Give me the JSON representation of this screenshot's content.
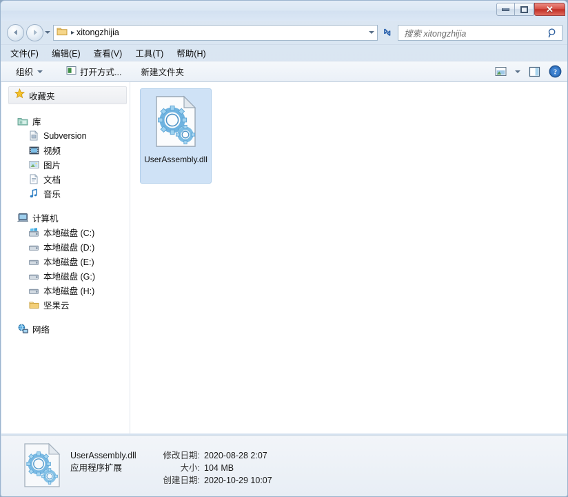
{
  "window": {
    "controls": {
      "minimize": "minimize-button",
      "maximize": "maximize-button",
      "close_label": "✕"
    }
  },
  "address_bar": {
    "folder_icon": "folder-icon",
    "separator": "▸",
    "path": "xitongzhijia",
    "dropdown_icon": "chevron-down-icon",
    "refresh_icon": "refresh-icon"
  },
  "search": {
    "placeholder": "搜索 xitongzhijia",
    "icon": "search-icon"
  },
  "menu": {
    "items": [
      {
        "label": "文件(F)"
      },
      {
        "label": "编辑(E)"
      },
      {
        "label": "查看(V)"
      },
      {
        "label": "工具(T)"
      },
      {
        "label": "帮助(H)"
      }
    ]
  },
  "toolbar": {
    "organize_label": "组织",
    "open_with_label": "打开方式...",
    "new_folder_label": "新建文件夹",
    "view_icon": "view-options-icon",
    "view_caret": "chevron-down-icon",
    "preview_pane_icon": "preview-pane-icon",
    "help_icon": "help-icon"
  },
  "sidebar": {
    "favorites": {
      "label": "收藏夹",
      "icon": "star-icon"
    },
    "groups": [
      {
        "header": {
          "label": "库",
          "icon": "library-folder-icon"
        },
        "items": [
          {
            "label": "Subversion",
            "icon": "subversion-icon"
          },
          {
            "label": "视频",
            "icon": "video-icon"
          },
          {
            "label": "图片",
            "icon": "picture-icon"
          },
          {
            "label": "文档",
            "icon": "document-icon"
          },
          {
            "label": "音乐",
            "icon": "music-icon"
          }
        ]
      },
      {
        "header": {
          "label": "计算机",
          "icon": "computer-icon"
        },
        "items": [
          {
            "label": "本地磁盘 (C:)",
            "icon": "system-drive-icon"
          },
          {
            "label": "本地磁盘 (D:)",
            "icon": "drive-icon"
          },
          {
            "label": "本地磁盘 (E:)",
            "icon": "drive-icon"
          },
          {
            "label": "本地磁盘 (G:)",
            "icon": "drive-icon"
          },
          {
            "label": "本地磁盘 (H:)",
            "icon": "drive-icon"
          },
          {
            "label": "坚果云",
            "icon": "folder-icon"
          }
        ]
      },
      {
        "header": {
          "label": "网络",
          "icon": "network-icon"
        },
        "items": []
      }
    ]
  },
  "content": {
    "files": [
      {
        "name": "UserAssembly.dll",
        "icon": "dll-icon",
        "selected": true
      }
    ]
  },
  "status_bar": {
    "icon": "dll-icon",
    "file_name": "UserAssembly.dll",
    "file_type": "应用程序扩展",
    "modified_key": "修改日期:",
    "modified_value": "2020-08-28 2:07",
    "size_key": "大小:",
    "size_value": "104 MB",
    "created_key": "创建日期:",
    "created_value": "2020-10-29 10:07"
  },
  "colors": {
    "selection": "#cfe2f6",
    "close_button": "#c02f26",
    "title_bar": "#dbe7f4"
  }
}
